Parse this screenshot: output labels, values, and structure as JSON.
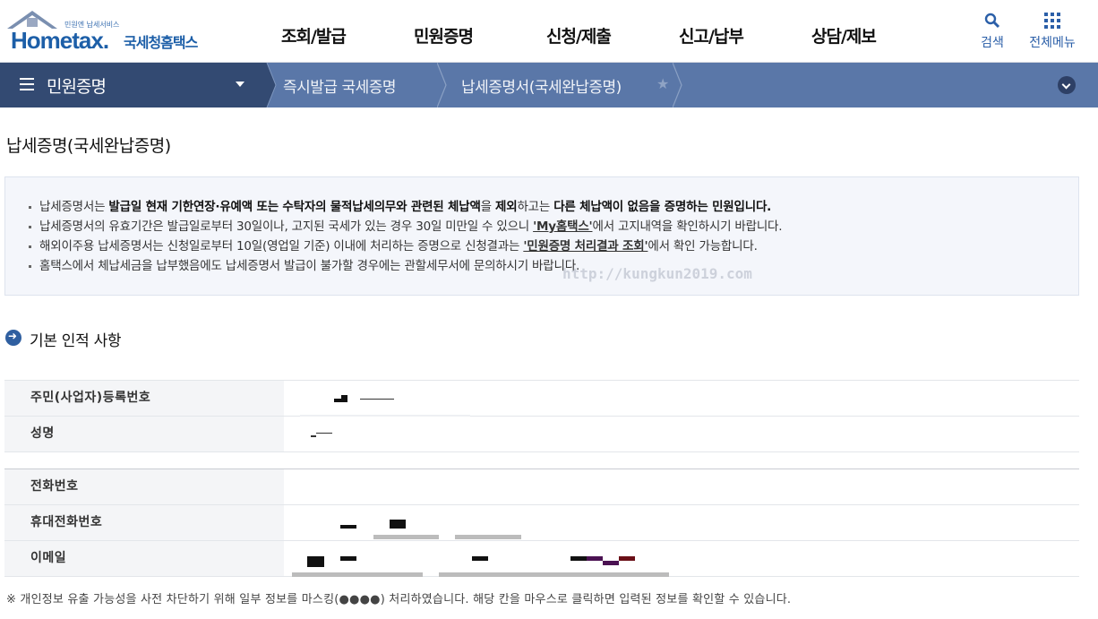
{
  "header": {
    "logo_small": "민원엔 납세서비스",
    "logo_brand_a": "Hom",
    "logo_brand_b": "etax.",
    "logo_korean": "국세청홈택스",
    "nav": [
      "조회/발급",
      "민원증명",
      "신청/제출",
      "신고/납부",
      "상담/제보"
    ],
    "search_label": "검색",
    "menu_label": "전체메뉴"
  },
  "location": {
    "menu_title": "민원증명",
    "crumbs": [
      "즉시발급 국세증명",
      "납세증명서(국세완납증명)"
    ]
  },
  "page": {
    "title": "납세증명(국세완납증명)"
  },
  "info": {
    "l1_a": "납세증명서는 ",
    "l1_b": "발급일 현재 기한연장·유예액 또는 수탁자의 물적납세의무와 관련된 체납액",
    "l1_c": "을 ",
    "l1_d": "제외",
    "l1_e": "하고는 ",
    "l1_f": "다른 체납액이 없음을 증명하는 민원입니다.",
    "l2_a": "납세증명서의 유효기간은 발급일로부터 30일이나, 고지된 국세가 있는 경우 30일 미만일 수 있으니 ",
    "l2_link": "'My홈택스'",
    "l2_b": "에서 고지내역을 확인하시기 바랍니다.",
    "l3_a": "해외이주용 납세증명서는 신청일로부터 10일(영업일 기준) 이내에 처리하는 증명으로 신청결과는 ",
    "l3_link": "'민원증명 처리결과 조회'",
    "l3_b": "에서 확인 가능합니다.",
    "l4": "홈택스에서 체납세금을 납부했음에도 납세증명서 발급이 불가할 경우에는 관할세무서에 문의하시기 바랍니다."
  },
  "watermark": "http://kungkun2019.com",
  "section": {
    "title": "기본 인적 사항"
  },
  "fields": {
    "rrn_label": "주민(사업자)등록번호",
    "name_label": "성명",
    "phone_label": "전화번호",
    "mobile_label": "휴대전화번호",
    "email_label": "이메일"
  },
  "note": "※ 개인정보 유출 가능성을 사전 차단하기 위해 일부 정보를 마스킹(●●●●) 처리하였습니다. 해당 칸을 마우스로 클릭하면 입력된 정보를 확인할 수 있습니다."
}
